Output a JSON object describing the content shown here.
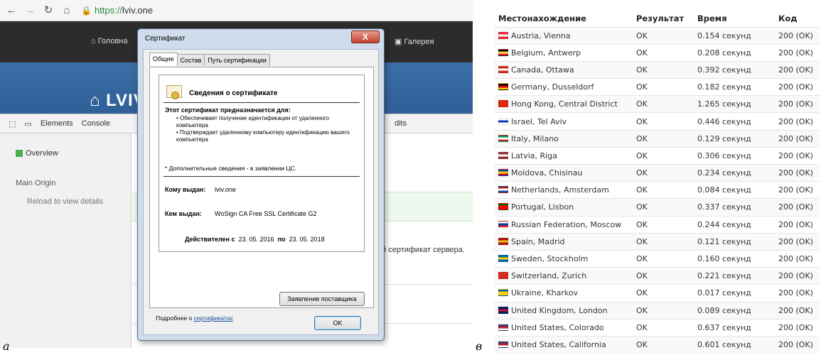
{
  "browser": {
    "url_scheme": "https://",
    "url_host": "lviv.one"
  },
  "site": {
    "nav_home": "Головна",
    "nav_gallery": "Галерея",
    "title": "LVIV"
  },
  "devtools": {
    "tab_elements": "Elements",
    "tab_console": "Console",
    "tab_audits_partial": "dits",
    "side_overview": "Overview",
    "side_main_origin": "Main Origin",
    "side_reload": "Reload to view details",
    "behind_text": "й сертификат сервера."
  },
  "dialog": {
    "title": "Сертификат",
    "close": "X",
    "tabs": [
      "Общие",
      "Состав",
      "Путь сертификации"
    ],
    "info_header": "Сведения о сертификате",
    "purpose_title": "Этот сертификат предназначается для:",
    "purposes": [
      "• Обеспечивает получение идентификации от удаленного компьютера",
      "• Подтверждает удаленному компьютеру идентификацию вашего компьютера"
    ],
    "note": "* Дополнительные сведения - в заявлении ЦС.",
    "issued_to_label": "Кому выдан:",
    "issued_to_value": "lviv.one",
    "issued_by_label": "Кем выдан:",
    "issued_by_value": "WoSign CA Free SSL Certificate G2",
    "valid_from_label": "Действителен с",
    "valid_from": "23. 05. 2016",
    "valid_to_label": "по",
    "valid_to": "23. 05. 2018",
    "issuer_statement_button": "Заявление поставщика",
    "more_prefix": "Подробнее о ",
    "more_link": "сертификатах",
    "ok_button": "OK"
  },
  "figure_labels": {
    "a": "а",
    "b": "в"
  },
  "table": {
    "headers": [
      "Местонахождение",
      "Результат",
      "Время",
      "Код"
    ],
    "rows": [
      {
        "flag": [
          "#ed2939",
          "#ffffff",
          "#ed2939"
        ],
        "location": "Austria, Vienna",
        "result": "OK",
        "time": "0.154 секунд",
        "code": "200 (OK)"
      },
      {
        "flag": [
          "#000000",
          "#fae042",
          "#ed2939"
        ],
        "location": "Belgium, Antwerp",
        "result": "OK",
        "time": "0.208 секунд",
        "code": "200 (OK)"
      },
      {
        "flag": [
          "#d52b1e",
          "#ffffff",
          "#d52b1e"
        ],
        "location": "Canada, Ottawa",
        "result": "OK",
        "time": "0.392 секунд",
        "code": "200 (OK)"
      },
      {
        "flag": [
          "#000000",
          "#dd0000",
          "#ffce00"
        ],
        "location": "Germany, Dusseldorf",
        "result": "OK",
        "time": "0.182 секунд",
        "code": "200 (OK)"
      },
      {
        "flag": [
          "#de2910",
          "#de2910",
          "#de2910"
        ],
        "location": "Hong Kong, Central District",
        "result": "OK",
        "time": "1.265 секунд",
        "code": "200 (OK)"
      },
      {
        "flag": [
          "#ffffff",
          "#0038b8",
          "#ffffff"
        ],
        "location": "Israel, Tel Aviv",
        "result": "OK",
        "time": "0.446 секунд",
        "code": "200 (OK)"
      },
      {
        "flag": [
          "#009246",
          "#ffffff",
          "#ce2b37"
        ],
        "location": "Italy, Milano",
        "result": "OK",
        "time": "0.129 секунд",
        "code": "200 (OK)"
      },
      {
        "flag": [
          "#9e3039",
          "#ffffff",
          "#9e3039"
        ],
        "location": "Latvia, Riga",
        "result": "OK",
        "time": "0.306 секунд",
        "code": "200 (OK)"
      },
      {
        "flag": [
          "#0046ae",
          "#ffd200",
          "#cc092f"
        ],
        "location": "Moldova, Chisinau",
        "result": "OK",
        "time": "0.234 секунд",
        "code": "200 (OK)"
      },
      {
        "flag": [
          "#ae1c28",
          "#ffffff",
          "#21468b"
        ],
        "location": "Netherlands, Amsterdam",
        "result": "OK",
        "time": "0.084 секунд",
        "code": "200 (OK)"
      },
      {
        "flag": [
          "#006600",
          "#ff0000",
          "#ff0000"
        ],
        "location": "Portugal, Lisbon",
        "result": "OK",
        "time": "0.337 секунд",
        "code": "200 (OK)"
      },
      {
        "flag": [
          "#ffffff",
          "#0039a6",
          "#d52b1e"
        ],
        "location": "Russian Federation, Moscow",
        "result": "OK",
        "time": "0.244 секунд",
        "code": "200 (OK)"
      },
      {
        "flag": [
          "#aa151b",
          "#f1bf00",
          "#aa151b"
        ],
        "location": "Spain, Madrid",
        "result": "OK",
        "time": "0.121 секунд",
        "code": "200 (OK)"
      },
      {
        "flag": [
          "#006aa7",
          "#fecc00",
          "#006aa7"
        ],
        "location": "Sweden, Stockholm",
        "result": "OK",
        "time": "0.160 секунд",
        "code": "200 (OK)"
      },
      {
        "flag": [
          "#d52b1e",
          "#d52b1e",
          "#d52b1e"
        ],
        "location": "Switzerland, Zurich",
        "result": "OK",
        "time": "0.221 секунд",
        "code": "200 (OK)"
      },
      {
        "flag": [
          "#0057b7",
          "#ffd700",
          "#ffd700"
        ],
        "location": "Ukraine, Kharkov",
        "result": "OK",
        "time": "0.017 секунд",
        "code": "200 (OK)"
      },
      {
        "flag": [
          "#012169",
          "#c8102e",
          "#012169"
        ],
        "location": "United Kingdom, London",
        "result": "OK",
        "time": "0.089 секунд",
        "code": "200 (OK)"
      },
      {
        "flag": [
          "#3c3b6e",
          "#b22234",
          "#ffffff"
        ],
        "location": "United States, Colorado",
        "result": "OK",
        "time": "0.637 секунд",
        "code": "200 (OK)"
      },
      {
        "flag": [
          "#3c3b6e",
          "#b22234",
          "#ffffff"
        ],
        "location": "United States, California",
        "result": "OK",
        "time": "0.601 секунд",
        "code": "200 (OK)"
      }
    ]
  }
}
